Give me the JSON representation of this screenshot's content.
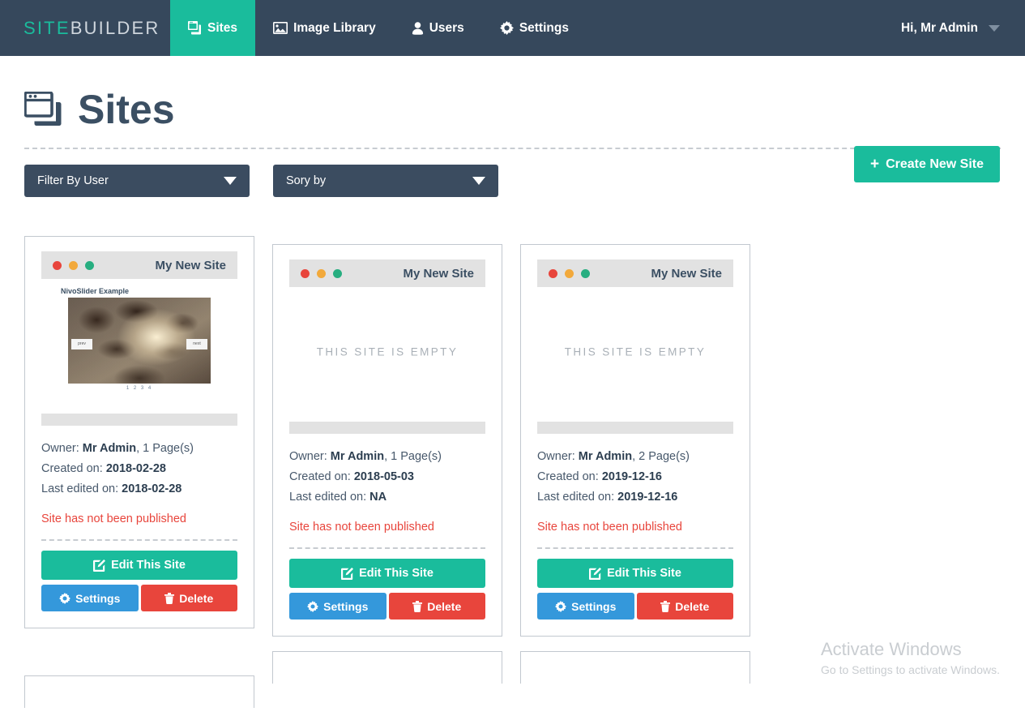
{
  "navbar": {
    "brand_first": "SITE",
    "brand_second": "BUILDER",
    "items": [
      {
        "label": "Sites",
        "icon": "clone-icon",
        "active": true
      },
      {
        "label": "Image Library",
        "icon": "image-icon",
        "active": false
      },
      {
        "label": "Users",
        "icon": "user-icon",
        "active": false
      },
      {
        "label": "Settings",
        "icon": "gear-icon",
        "active": false
      }
    ],
    "user_greeting": "Hi, Mr Admin",
    "user_caret": "chevron-down-icon"
  },
  "header": {
    "title": "Sites",
    "title_icon": "clone-icon",
    "create_button": "Create New Site",
    "create_button_icon": "plus-icon"
  },
  "filters": {
    "user_filter": "Filter By User",
    "sort_filter": "Sory by"
  },
  "labels": {
    "owner_prefix": "Owner: ",
    "created_prefix": "Created on: ",
    "edited_prefix": "Last edited on: ",
    "empty_preview": "THIS SITE IS EMPTY",
    "edit_button": "Edit This Site",
    "settings_button": "Settings",
    "delete_button": "Delete"
  },
  "cards": [
    {
      "preview_title": "My New Site",
      "preview_type": "nivoslider",
      "nivo_title": "NivoSlider Example",
      "nivo_prev": "prev",
      "nivo_next": "next",
      "nivo_dots": "1 2 3 4",
      "owner": "Mr Admin",
      "pages": ", 1 Page(s)",
      "created": "2018-02-28",
      "edited": "2018-02-28",
      "status": "Site has not been published"
    },
    {
      "preview_title": "My New Site",
      "preview_type": "empty",
      "owner": "Mr Admin",
      "pages": ", 1 Page(s)",
      "created": "2018-05-03",
      "edited": "NA",
      "status": "Site has not been published"
    },
    {
      "preview_title": "My New Site",
      "preview_type": "empty",
      "owner": "Mr Admin",
      "pages": ", 2 Page(s)",
      "created": "2019-12-16",
      "edited": "2019-12-16",
      "status": "Site has not been published"
    }
  ],
  "watermark": {
    "title": "Activate Windows",
    "subtitle": "Go to Settings to activate Windows."
  },
  "colors": {
    "navbar": "#36485c",
    "accent_teal": "#1abc9c",
    "blue": "#3498db",
    "red": "#e8453c",
    "dark_text": "#2c3e50"
  }
}
